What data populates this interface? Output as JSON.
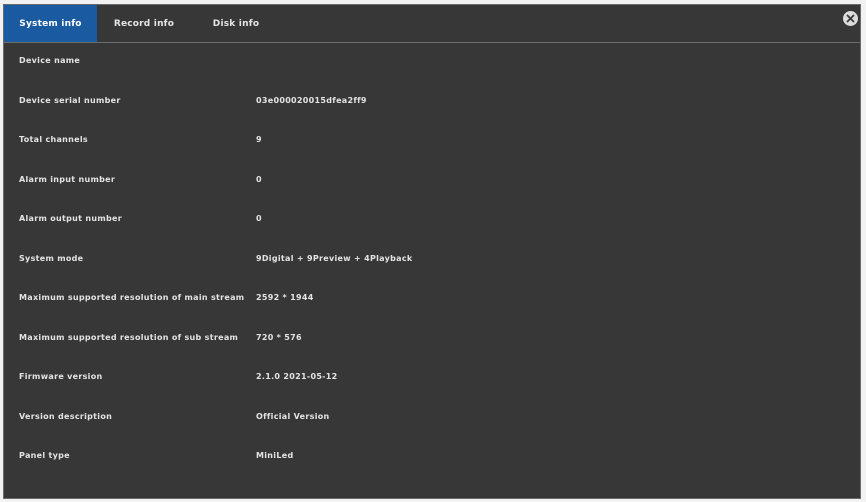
{
  "tabs": [
    {
      "label": "System info",
      "active": true
    },
    {
      "label": "Record info",
      "active": false
    },
    {
      "label": "Disk info",
      "active": false
    }
  ],
  "close_icon": "close-icon",
  "info": [
    {
      "label": "Device name",
      "value": ""
    },
    {
      "label": "Device serial number",
      "value": "03e000020015dfea2ff9"
    },
    {
      "label": "Total channels",
      "value": "9"
    },
    {
      "label": "Alarm input number",
      "value": "0"
    },
    {
      "label": "Alarm output number",
      "value": "0"
    },
    {
      "label": "System mode",
      "value": "9Digital + 9Preview + 4Playback"
    },
    {
      "label": "Maximum supported resolution of main stream",
      "value": "2592 * 1944"
    },
    {
      "label": "Maximum supported resolution of sub stream",
      "value": "720 * 576"
    },
    {
      "label": "Firmware version",
      "value": "2.1.0 2021-05-12"
    },
    {
      "label": "Version description",
      "value": "Official Version"
    },
    {
      "label": "Panel type",
      "value": "MiniLed"
    }
  ],
  "colors": {
    "background": "#373737",
    "active_tab": "#1a5aa0",
    "text": "#e4e4e4"
  }
}
